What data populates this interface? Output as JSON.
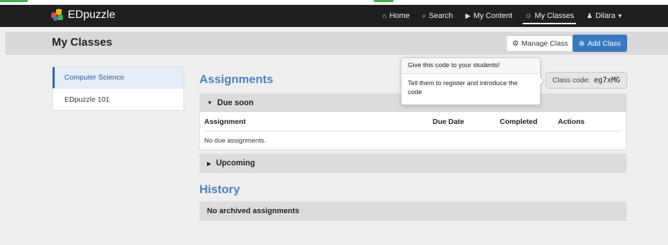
{
  "app": {
    "brand": "EDpuzzle",
    "accent_color": "#3a78c2"
  },
  "navbar": {
    "items": [
      {
        "icon": "home-icon",
        "label": "Home"
      },
      {
        "icon": "search-icon",
        "label": "Search"
      },
      {
        "icon": "video-icon",
        "label": "My Content"
      },
      {
        "icon": "users-icon",
        "label": "My Classes"
      },
      {
        "icon": "user-icon",
        "label": "Dilara"
      }
    ]
  },
  "header": {
    "title": "My Classes",
    "manage_label": "Manage Class",
    "add_label": "Add Class"
  },
  "sidebar": {
    "items": [
      {
        "label": "Computer Science"
      },
      {
        "label": "EDpuzzle 101"
      }
    ]
  },
  "main": {
    "assignments_heading": "Assignments",
    "due_soon_label": "Due soon",
    "table": {
      "columns": [
        "Assignment",
        "Due Date",
        "Completed",
        "Actions"
      ],
      "empty_text": "No due assignments."
    },
    "upcoming_label": "Upcoming",
    "history_heading": "History",
    "archived_text": "No archived assignments"
  },
  "class_code": {
    "label": "Class code:",
    "value": "eg7xMG"
  },
  "popover": {
    "title": "Give this code to your students!",
    "body": "Tell them to register and introduce the code"
  }
}
